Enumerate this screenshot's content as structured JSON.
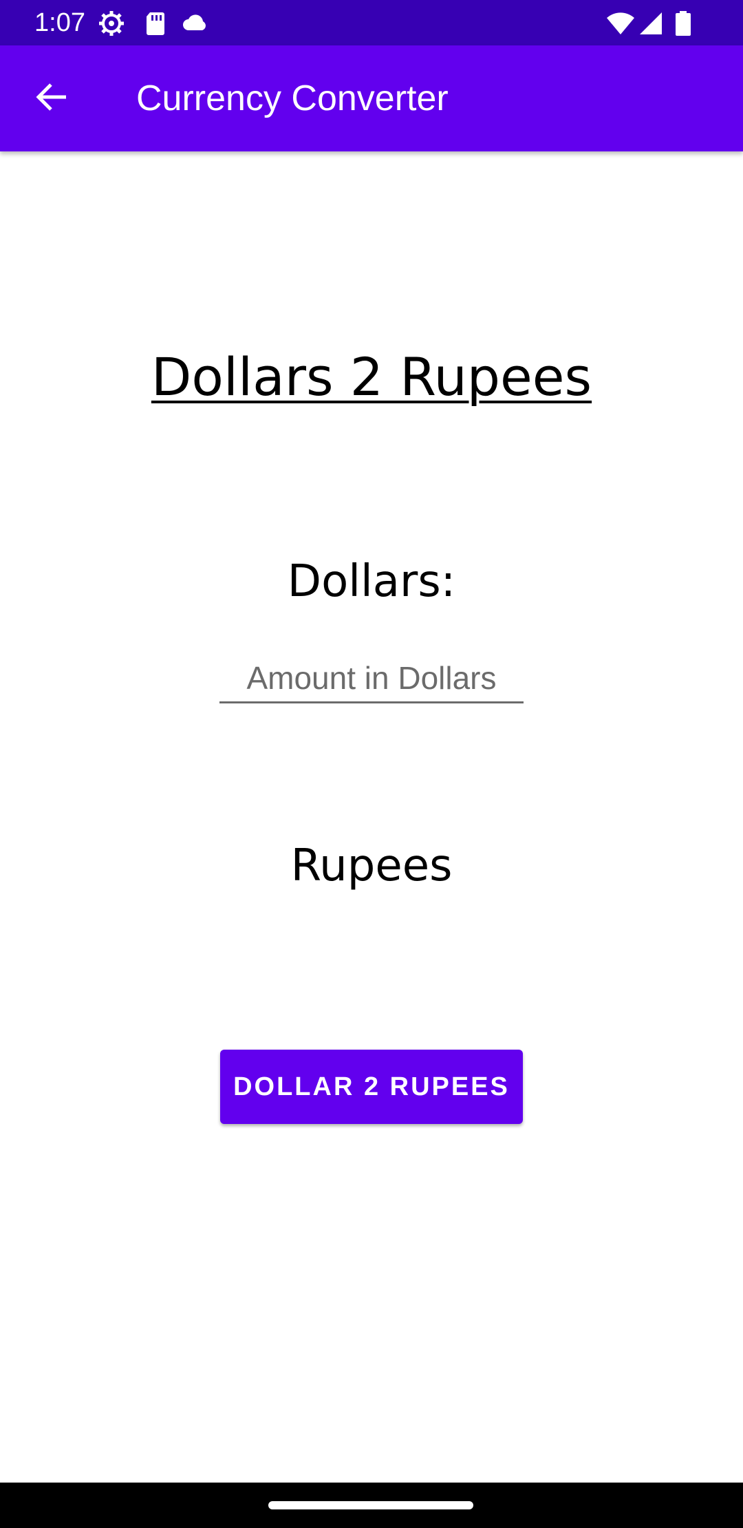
{
  "status_bar": {
    "time": "1:07",
    "icons": [
      "settings-icon",
      "sd-card-icon",
      "cloud-icon",
      "wifi-icon",
      "signal-icon",
      "battery-icon"
    ],
    "background_color": "#3700b3"
  },
  "app_bar": {
    "title": "Currency Converter",
    "back_icon": "arrow-back-icon",
    "background_color": "#6200ee"
  },
  "main": {
    "heading": "Dollars 2 Rupees",
    "dollars_label": "Dollars:",
    "amount_input": {
      "value": "",
      "placeholder": "Amount in Dollars"
    },
    "rupees_label": "Rupees",
    "convert_button_label": "DOLLAR 2 RUPEES"
  },
  "nav_bar": {
    "home_handle": "home-gesture-bar"
  }
}
